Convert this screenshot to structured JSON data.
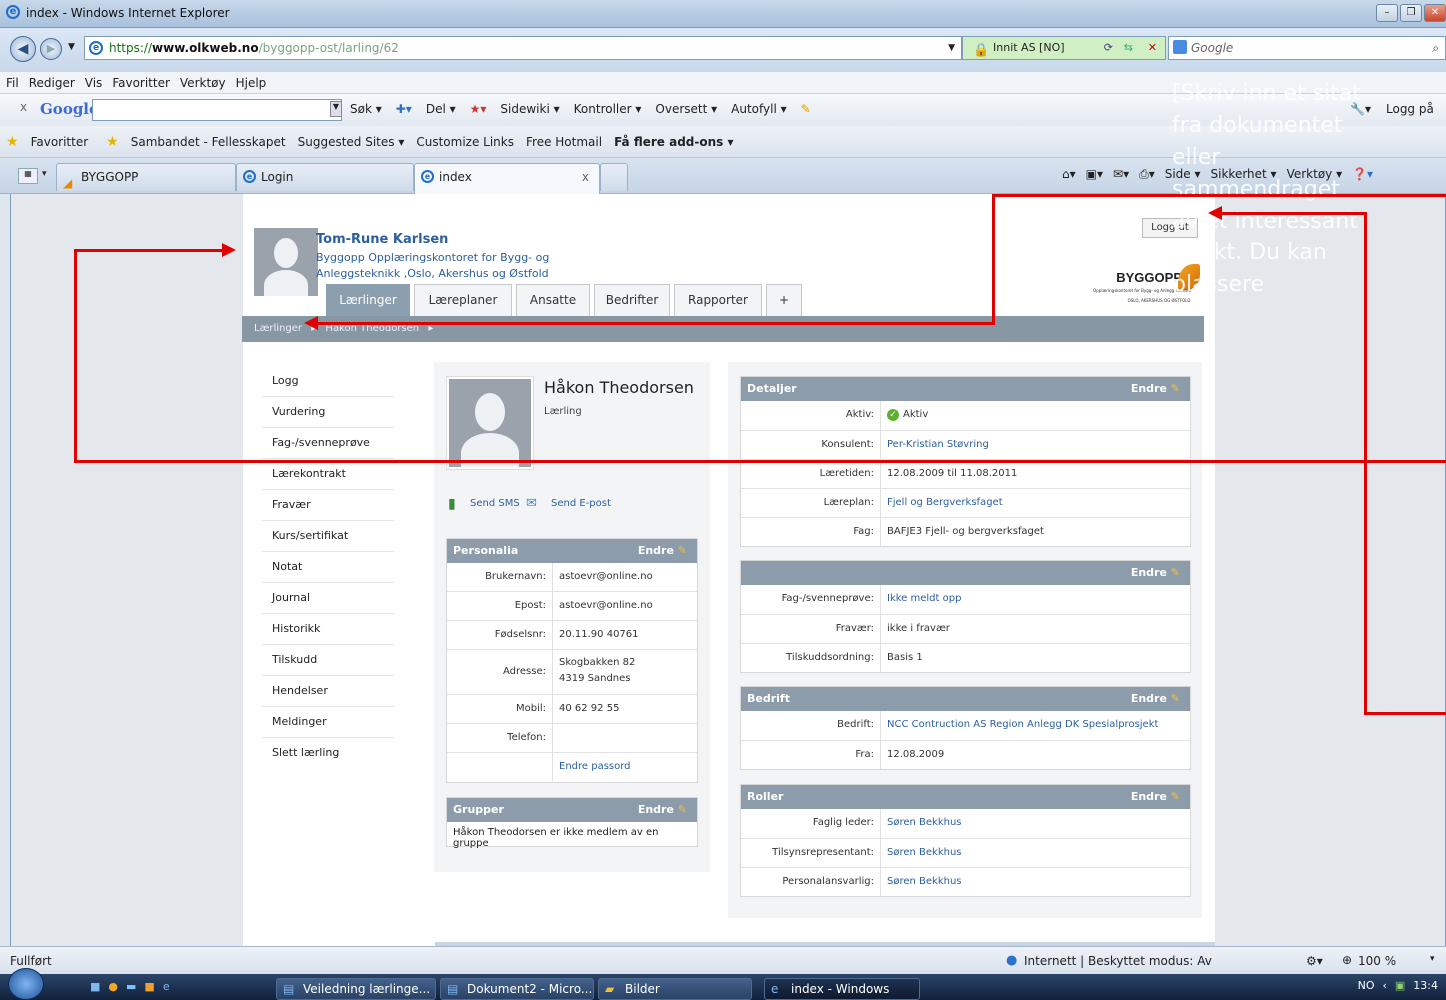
{
  "window": {
    "title": "index - Windows Internet Explorer"
  },
  "address": {
    "proto": "https://",
    "host": "www.olkweb.no",
    "path": "/byggopp-ost/larling/62",
    "security": "Innit AS [NO]",
    "search_placeholder": "Google"
  },
  "menu": [
    "Fil",
    "Rediger",
    "Vis",
    "Favoritter",
    "Verktøy",
    "Hjelp"
  ],
  "gtoolbar": {
    "brand": "Google",
    "items": [
      "Søk ▾",
      "Del ▾",
      "Sidewiki ▾",
      "Kontroller ▾",
      "Oversett ▾",
      "Autofyll ▾"
    ],
    "login": "Logg på"
  },
  "favbar": {
    "label": "Favoritter",
    "items": [
      "Sambandet - Fellesskapet",
      "Suggested Sites ▾",
      "Customize Links",
      "Free Hotmail",
      "Få flere add-ons ▾"
    ]
  },
  "tabs": [
    "BYGGOPP",
    "Login",
    "index"
  ],
  "cmdbar": [
    "Side ▾",
    "Sikkerhet ▾",
    "Verktøy ▾"
  ],
  "quote": "[Skriv inn et sitat fra dokumentet eller sammendraget av et interessant punkt. Du kan plassere",
  "header": {
    "name": "Tom-Rune Karlsen",
    "org": "Byggopp Opplæringskontoret for Bygg- og Anleggsteknikk ,Oslo, Akershus og Østfold",
    "logout": "Logg ut",
    "logo": "BYGGOPP",
    "logo_sub1": "Opplæringskontoret for Bygg- og Anleggsteknikk",
    "logo_sub2": "OSLO, AKERSHUS OG ØSTFOLD"
  },
  "apptabs": [
    "Lærlinger",
    "Læreplaner",
    "Ansatte",
    "Bedrifter",
    "Rapporter",
    "+"
  ],
  "breadcrumb": [
    "Lærlinger",
    "Håkon Theodorsen"
  ],
  "sidemenu": [
    "Logg",
    "Vurdering",
    "Fag-/svenneprøve",
    "Lærekontrakt",
    "Fravær",
    "Kurs/sertifikat",
    "Notat",
    "Journal",
    "Historikk",
    "Tilskudd",
    "Hendelser",
    "Meldinger",
    "Slett lærling"
  ],
  "profile": {
    "name": "Håkon Theodorsen",
    "role": "Lærling",
    "sms": "Send SMS",
    "email": "Send E-post"
  },
  "edit": "Endre",
  "personalia": {
    "title": "Personalia",
    "rows": [
      {
        "k": "Brukernavn:",
        "v": "astoevr@online.no"
      },
      {
        "k": "Epost:",
        "v": "astoevr@online.no"
      },
      {
        "k": "Fødselsnr:",
        "v": "20.11.90 40761"
      },
      {
        "k": "Adresse:",
        "v": "Skogbakken 82",
        "v2": "4319 Sandnes"
      },
      {
        "k": "Mobil:",
        "v": "40 62 92 55"
      },
      {
        "k": "Telefon:",
        "v": ""
      },
      {
        "k": "",
        "v": "Endre passord"
      }
    ]
  },
  "grupper": {
    "title": "Grupper",
    "text": "Håkon Theodorsen er ikke medlem av en gruppe"
  },
  "detaljer": {
    "title": "Detaljer",
    "rows": [
      {
        "k": "Aktiv:",
        "v": "Aktiv"
      },
      {
        "k": "Konsulent:",
        "v": "Per-Kristian Støvring"
      },
      {
        "k": "Læretiden:",
        "v": "12.08.2009 til 11.08.2011"
      },
      {
        "k": "Læreplan:",
        "v": "Fjell og Bergverksfaget"
      },
      {
        "k": "Fag:",
        "v": "BAFJE3 Fjell- og bergverksfaget"
      }
    ]
  },
  "panel2": {
    "rows": [
      {
        "k": "Fag-/svenneprøve:",
        "v": "Ikke meldt opp"
      },
      {
        "k": "Fravær:",
        "v": "ikke i fravær"
      },
      {
        "k": "Tilskuddsordning:",
        "v": "Basis 1"
      }
    ]
  },
  "bedrift": {
    "title": "Bedrift",
    "rows": [
      {
        "k": "Bedrift:",
        "v": "NCC Contruction AS Region Anlegg DK Spesialprosjekt"
      },
      {
        "k": "Fra:",
        "v": "12.08.2009"
      }
    ]
  },
  "roller": {
    "title": "Roller",
    "rows": [
      {
        "k": "Faglig leder:",
        "v": "Søren Bekkhus"
      },
      {
        "k": "Tilsynsrepresentant:",
        "v": "Søren Bekkhus"
      },
      {
        "k": "Personalansvarlig:",
        "v": "Søren Bekkhus"
      }
    ]
  },
  "status": {
    "left": "Fullført",
    "zone": "Internett | Beskyttet modus: Av",
    "zoom": "100 %"
  },
  "taskbar": {
    "items": [
      "Veiledning lærlinge...",
      "Dokument2 - Micro...",
      "Bilder",
      "index - Windows Int..."
    ],
    "lang": "NO",
    "clock": "13:4"
  },
  "colors": {
    "accent": "#8c9cab",
    "link": "#2c5f9e",
    "annotation": "#e00000"
  }
}
